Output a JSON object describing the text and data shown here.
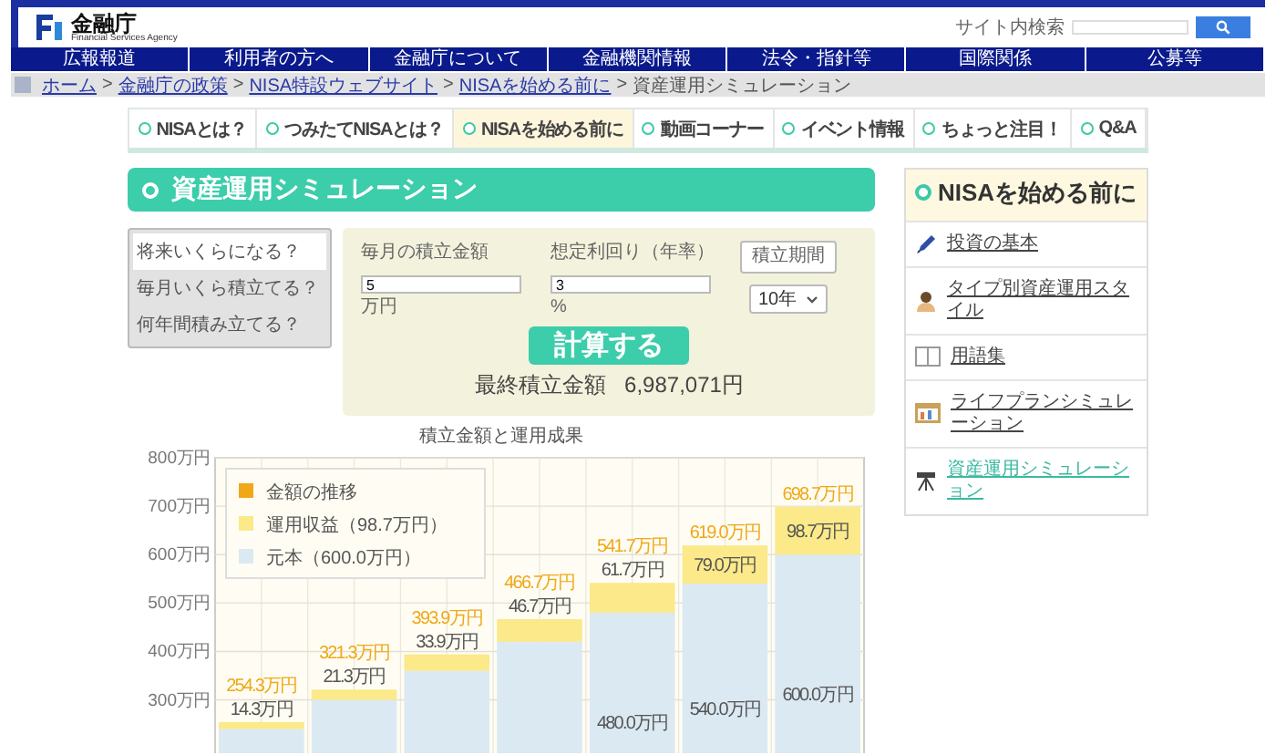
{
  "header": {
    "logo_text": "金融庁",
    "logo_subtitle": "Financial Services Agency",
    "search_label": "サイト内検索"
  },
  "nav": [
    "広報報道",
    "利用者の方へ",
    "金融庁について",
    "金融機関情報",
    "法令・指針等",
    "国際関係",
    "公募等"
  ],
  "breadcrumb": {
    "separator": ">",
    "items": [
      "ホーム",
      "金融庁の政策",
      "NISA特設ウェブサイト",
      "NISAを始める前に",
      "資産運用シミュレーション"
    ]
  },
  "tabs": [
    {
      "label": "NISAとは？",
      "selected": false
    },
    {
      "label": "つみたてNISAとは？",
      "selected": false
    },
    {
      "label": "NISAを始める前に",
      "selected": true
    },
    {
      "label": "動画コーナー",
      "selected": false
    },
    {
      "label": "イベント情報",
      "selected": false
    },
    {
      "label": "ちょっと注目！",
      "selected": false
    },
    {
      "label": "Q&A",
      "selected": false
    }
  ],
  "page_title": "資産運用シミュレーション",
  "modes": [
    {
      "label": "将来いくらになる？",
      "selected": true
    },
    {
      "label": "毎月いくら積立てる？",
      "selected": false
    },
    {
      "label": "何年間積み立てる？",
      "selected": false
    }
  ],
  "form": {
    "fields": [
      {
        "kind": "input",
        "label": "毎月の積立金額",
        "value": "5",
        "unit": "万円"
      },
      {
        "kind": "input",
        "label": "想定利回り（年率）",
        "value": "3",
        "unit": "%"
      },
      {
        "kind": "select",
        "label": "積立期間",
        "value": "10年"
      }
    ],
    "button": "計算する",
    "result_label": "最終積立金額",
    "result_value": "6,987,071円"
  },
  "chart": {
    "chart_data": {
      "type": "bar",
      "title": "積立金額と運用成果",
      "stacked": true,
      "grid": true,
      "legend": true,
      "ylim": [
        0,
        800
      ],
      "yticks": [
        {
          "value": 300,
          "label": "300万円"
        },
        {
          "value": 400,
          "label": "400万円"
        },
        {
          "value": 500,
          "label": "500万円"
        },
        {
          "value": 600,
          "label": "600万円"
        },
        {
          "value": 700,
          "label": "700万円"
        },
        {
          "value": 800,
          "label": "800万円"
        }
      ],
      "series": [
        {
          "name": "元本（600.0万円）",
          "color": "#dbe9f3",
          "values": [
            240,
            300,
            360,
            420,
            480,
            540,
            600
          ]
        },
        {
          "name": "運用収益（98.7万円）",
          "color": "#fbe98a",
          "values": [
            14.3,
            21.3,
            33.9,
            46.7,
            61.7,
            79.0,
            98.7
          ]
        }
      ],
      "value_labels": [
        "254.3万円",
        "321.3万円",
        "393.9万円",
        "466.7万円",
        "541.7万円",
        "619.0万円",
        "698.7万円"
      ]
    },
    "total_legend": {
      "label": "金額の推移",
      "color": "#f0a818"
    },
    "segment_labels": {
      "profit": [
        "14.3万円",
        "21.3万円",
        "33.9万円",
        "46.7万円",
        "61.7万円",
        "79.0万円",
        "98.7万円"
      ],
      "principal": [
        "480.0万円",
        "540.0万円",
        "600.0万円"
      ]
    }
  },
  "sidebar": {
    "title": "NISAを始める前に",
    "items": [
      {
        "kind": "pen",
        "label": "投資の基本",
        "selected": false
      },
      {
        "kind": "person",
        "label": "タイプ別資産運用スタイル",
        "selected": false
      },
      {
        "kind": "book",
        "label": "用語集",
        "selected": false
      },
      {
        "kind": "chart",
        "label": "ライフプランシミュレーション",
        "selected": false
      },
      {
        "kind": "tripod",
        "label": "資産運用シミュレーション",
        "selected": true
      }
    ]
  }
}
